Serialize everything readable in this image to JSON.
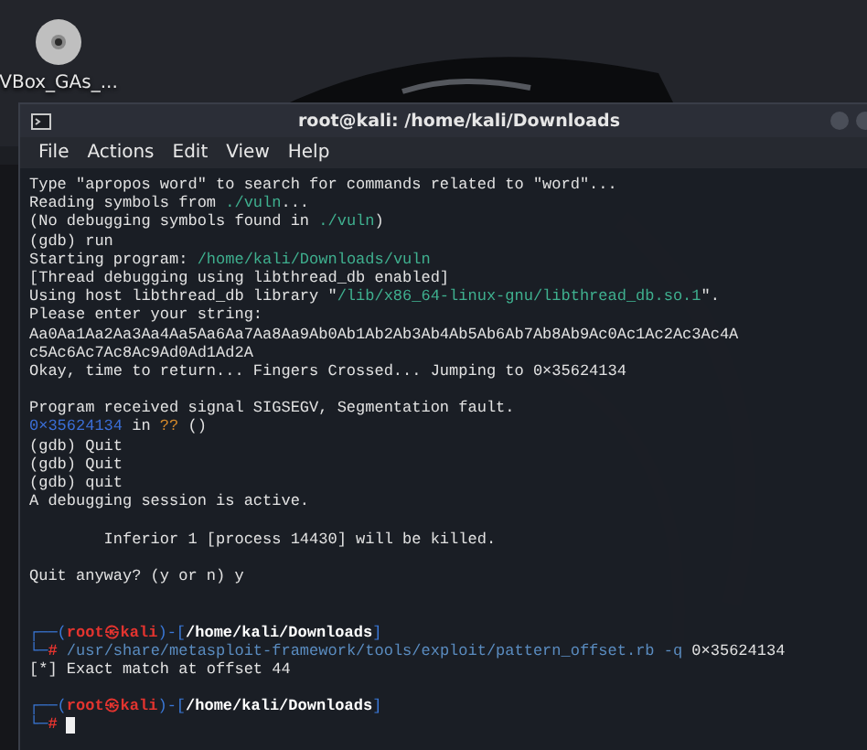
{
  "desktop": {
    "icons": [
      {
        "label": "VBox_GAs_..."
      }
    ]
  },
  "terminal": {
    "title": "root@kali: /home/kali/Downloads",
    "menu": [
      "File",
      "Actions",
      "Edit",
      "View",
      "Help"
    ],
    "lines": [
      {
        "kind": "text",
        "segments": [
          {
            "kind": "plain",
            "text": "Type \"apropos word\" to search for commands related to \"word\"..."
          }
        ]
      },
      {
        "kind": "text",
        "segments": [
          {
            "kind": "plain",
            "text": "Reading symbols from "
          },
          {
            "kind": "path",
            "text": "./vuln"
          },
          {
            "kind": "plain",
            "text": "..."
          }
        ]
      },
      {
        "kind": "text",
        "segments": [
          {
            "kind": "plain",
            "text": "(No debugging symbols found in "
          },
          {
            "kind": "path",
            "text": "./vuln"
          },
          {
            "kind": "plain",
            "text": ")"
          }
        ]
      },
      {
        "kind": "text",
        "segments": [
          {
            "kind": "plain",
            "text": "(gdb) run"
          }
        ]
      },
      {
        "kind": "text",
        "segments": [
          {
            "kind": "plain",
            "text": "Starting program: "
          },
          {
            "kind": "path",
            "text": "/home/kali/Downloads/vuln"
          }
        ]
      },
      {
        "kind": "text",
        "segments": [
          {
            "kind": "plain",
            "text": "[Thread debugging using libthread_db enabled]"
          }
        ]
      },
      {
        "kind": "text",
        "segments": [
          {
            "kind": "plain",
            "text": "Using host libthread_db library \""
          },
          {
            "kind": "path",
            "text": "/lib/x86_64-linux-gnu/libthread_db.so.1"
          },
          {
            "kind": "plain",
            "text": "\"."
          }
        ]
      },
      {
        "kind": "text",
        "segments": [
          {
            "kind": "plain",
            "text": "Please enter your string:"
          }
        ]
      },
      {
        "kind": "text",
        "segments": [
          {
            "kind": "plain",
            "text": "Aa0Aa1Aa2Aa3Aa4Aa5Aa6Aa7Aa8Aa9Ab0Ab1Ab2Ab3Ab4Ab5Ab6Ab7Ab8Ab9Ac0Ac1Ac2Ac3Ac4A"
          }
        ]
      },
      {
        "kind": "text",
        "segments": [
          {
            "kind": "plain",
            "text": "c5Ac6Ac7Ac8Ac9Ad0Ad1Ad2A"
          }
        ]
      },
      {
        "kind": "text",
        "segments": [
          {
            "kind": "plain",
            "text": "Okay, time to return... Fingers Crossed... Jumping to 0×35624134"
          }
        ]
      },
      {
        "kind": "blank"
      },
      {
        "kind": "text",
        "segments": [
          {
            "kind": "plain",
            "text": "Program received signal SIGSEGV, Segmentation fault."
          }
        ]
      },
      {
        "kind": "text",
        "segments": [
          {
            "kind": "address",
            "text": "0×35624134"
          },
          {
            "kind": "plain",
            "text": " in "
          },
          {
            "kind": "unknown",
            "text": "??"
          },
          {
            "kind": "plain",
            "text": " ()"
          }
        ]
      },
      {
        "kind": "text",
        "segments": [
          {
            "kind": "plain",
            "text": "(gdb) Quit"
          }
        ]
      },
      {
        "kind": "text",
        "segments": [
          {
            "kind": "plain",
            "text": "(gdb) Quit"
          }
        ]
      },
      {
        "kind": "text",
        "segments": [
          {
            "kind": "plain",
            "text": "(gdb) quit"
          }
        ]
      },
      {
        "kind": "text",
        "segments": [
          {
            "kind": "plain",
            "text": "A debugging session is active."
          }
        ]
      },
      {
        "kind": "blank"
      },
      {
        "kind": "text",
        "segments": [
          {
            "kind": "plain",
            "text": "        Inferior 1 [process 14430] will be killed."
          }
        ]
      },
      {
        "kind": "blank"
      },
      {
        "kind": "text",
        "segments": [
          {
            "kind": "plain",
            "text": "Quit anyway? (y or n) y"
          }
        ]
      },
      {
        "kind": "blank"
      },
      {
        "kind": "blank"
      },
      {
        "kind": "text",
        "segments": [
          {
            "kind": "frame",
            "text": "┌──("
          },
          {
            "kind": "user",
            "text": "root㉿kali"
          },
          {
            "kind": "frame",
            "text": ")-["
          },
          {
            "kind": "cwd",
            "text": "/home/kali/Downloads"
          },
          {
            "kind": "frame",
            "text": "]"
          }
        ]
      },
      {
        "kind": "text",
        "segments": [
          {
            "kind": "frame",
            "text": "└─"
          },
          {
            "kind": "user",
            "text": "#"
          },
          {
            "kind": "command",
            "text": " /usr/share/metasploit-framework/tools/exploit/pattern_offset.rb -q"
          },
          {
            "kind": "plain",
            "text": " 0×35624134"
          }
        ]
      },
      {
        "kind": "text",
        "segments": [
          {
            "kind": "plain",
            "text": "[*] Exact match at offset 44"
          }
        ]
      },
      {
        "kind": "blank"
      },
      {
        "kind": "text",
        "segments": [
          {
            "kind": "frame",
            "text": "┌──("
          },
          {
            "kind": "user",
            "text": "root㉿kali"
          },
          {
            "kind": "frame",
            "text": ")-["
          },
          {
            "kind": "cwd",
            "text": "/home/kali/Downloads"
          },
          {
            "kind": "frame",
            "text": "]"
          }
        ]
      },
      {
        "kind": "text",
        "segments": [
          {
            "kind": "frame",
            "text": "└─"
          },
          {
            "kind": "user",
            "text": "#"
          },
          {
            "kind": "cursor"
          }
        ]
      }
    ]
  }
}
